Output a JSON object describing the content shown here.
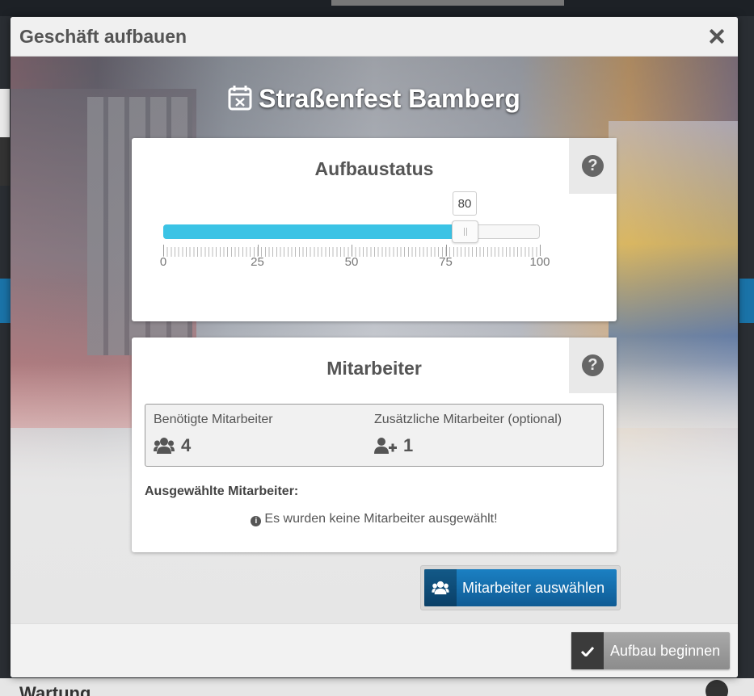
{
  "modal": {
    "title": "Geschäft aufbauen",
    "event_title": "Straßenfest Bamberg"
  },
  "status_panel": {
    "heading": "Aufbaustatus",
    "help": "?",
    "slider": {
      "value": 80,
      "value_label": "80",
      "min": 0,
      "max": 100
    },
    "tick_labels": [
      "0",
      "25",
      "50",
      "75",
      "100"
    ]
  },
  "staff_panel": {
    "heading": "Mitarbeiter",
    "help": "?",
    "required_label": "Benötigte Mitarbeiter",
    "required_value": "4",
    "additional_label": "Zusätzliche Mitarbeiter (optional)",
    "additional_value": "1",
    "selected_label": "Ausgewählte Mitarbeiter:",
    "empty_note": "Es wurden keine Mitarbeiter ausgewählt!",
    "info_glyph": "i"
  },
  "buttons": {
    "select_staff": "Mitarbeiter auswählen",
    "start_build": "Aufbau beginnen"
  },
  "background": {
    "section_title": "Wartung"
  },
  "colors": {
    "slider_fill": "#3bc3e5",
    "primary_button": "#1b80c3",
    "secondary_button": "#999999"
  },
  "icons": {
    "close": "close-icon",
    "calendar": "calendar-x-icon",
    "help": "question-circle-icon",
    "users": "users-icon",
    "user_plus": "user-plus-icon",
    "info": "info-circle-icon",
    "check": "check-icon"
  }
}
